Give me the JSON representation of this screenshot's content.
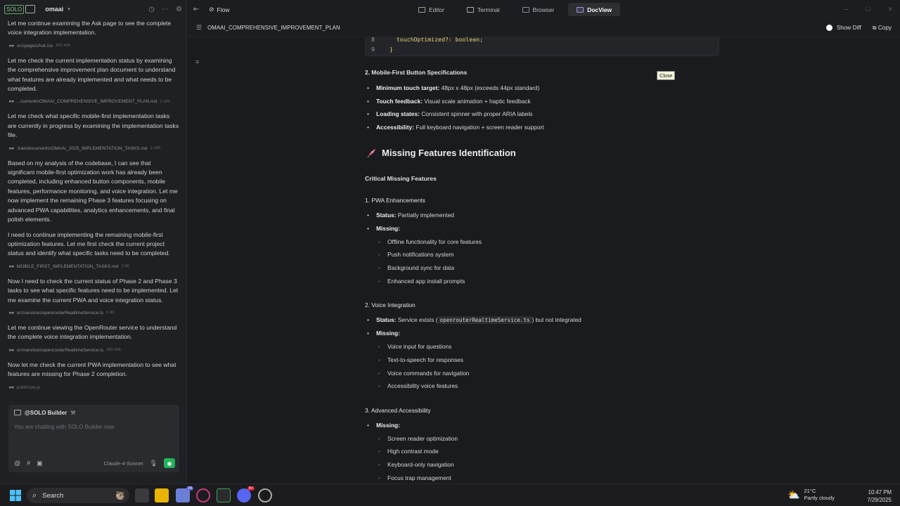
{
  "left_header": {
    "logo_text": "SOLO",
    "project": "omaai"
  },
  "chat": [
    {
      "text": "Let me continue examining the Ask page to see the complete voice integration implementation.",
      "ref": "src\\pages\\Ask.tsx",
      "range": "201-400"
    },
    {
      "text": "Let me check the current implementation status by examining the comprehensive improvement plan document to understand what features are already implemented and what needs to be completed.",
      "ref": "...cuments\\OMAAI_COMPREHENSIVE_IMPROVEMENT_PLAN.md",
      "range": "1-100"
    },
    {
      "text": "Let me check what specific mobile-first implementation tasks are currently in progress by examining the implementation tasks file.",
      "ref": ".trae\\documents\\OMAAI_2025_IMPLEMENTATION_TASKS.md",
      "range": "1-100"
    },
    {
      "text": "Based on my analysis of the codebase, I can see that significant mobile-first optimization work has already been completed, including enhanced button components, mobile features, performance monitoring, and voice integration. Let me now implement the remaining Phase 3 features focusing on advanced PWA capabilities, analytics enhancements, and final polish elements.",
      "ref": "",
      "range": ""
    },
    {
      "text": "I need to continue implementing the remaining mobile-first optimization features. Let me first check the current project status and identify what specific tasks need to be completed.",
      "ref": "MOBILE_FIRST_IMPLEMENTATION_TASKS.md",
      "range": "1-30"
    },
    {
      "text": "Now I need to check the current status of Phase 2 and Phase 3 tasks to see what specific features need to be implemented. Let me examine the current PWA and voice integration status.",
      "ref": "src\\services\\openrouterRealtimeService.ts",
      "range": "1-30"
    },
    {
      "text": "Let me continue viewing the OpenRouter service to understand the complete voice integration implementation.",
      "ref": "src\\services\\openrouterRealtimeService.ts",
      "range": "200-305"
    },
    {
      "text": "Now let me check the current PWA implementation to see what features are missing for Phase 2 completion.",
      "ref": "public\\sw.js",
      "range": ""
    }
  ],
  "composer": {
    "context": "@SOLO Builder",
    "placeholder": "You are chatting with SOLO Builder now",
    "model": "Claude-4-Sonnet"
  },
  "topbar": {
    "flow": "Flow",
    "tabs": [
      {
        "label": "Editor",
        "icon": "editor-icon"
      },
      {
        "label": "Terminal",
        "icon": "terminal-icon"
      },
      {
        "label": "Browser",
        "icon": "browser-icon"
      },
      {
        "label": "DocView",
        "icon": "docview-icon"
      }
    ],
    "active_tab": "DocView"
  },
  "doc_header": {
    "filename": "OMAAI_COMPREHENSIVE_IMPROVEMENT_PLAN",
    "show_diff": "Show Diff",
    "copy": "Copy"
  },
  "tooltip": "Close",
  "doc": {
    "code_lines": [
      {
        "n": "8",
        "code": "  touchOptimized?: boolean;"
      },
      {
        "n": "9",
        "code": "}"
      }
    ],
    "button_spec_title": "2. Mobile-First Button Specifications",
    "button_specs": [
      {
        "label": "Minimum touch target:",
        "text": "48px x 48px (exceeds 44px standard)"
      },
      {
        "label": "Touch feedback:",
        "text": "Visual scale animation + haptic feedback"
      },
      {
        "label": "Loading states:",
        "text": "Consistent spinner with proper ARIA labels"
      },
      {
        "label": "Accessibility:",
        "text": "Full keyboard navigation + screen reader support"
      }
    ],
    "missing_title": "Missing Features Identification",
    "critical_title": "Critical Missing Features",
    "pwa": {
      "title": "1. PWA Enhancements",
      "status_label": "Status:",
      "status": "Partially implemented",
      "missing_label": "Missing:",
      "items": [
        "Offline functionality for core features",
        "Push notifications system",
        "Background sync for data",
        "Enhanced app install prompts"
      ]
    },
    "voice": {
      "title": "2. Voice Integration",
      "status_label": "Status:",
      "status_pre": "Service exists (",
      "status_code": "openrouterRealtimeService.ts",
      "status_post": ") but not integrated",
      "missing_label": "Missing:",
      "items": [
        "Voice input for questions",
        "Text-to-speech for responses",
        "Voice commands for navigation",
        "Accessibility voice features"
      ]
    },
    "a11y": {
      "title": "3. Advanced Accessibility",
      "missing_label": "Missing:",
      "items": [
        "Screen reader optimization",
        "High contrast mode",
        "Keyboard-only navigation",
        "Focus trap management"
      ]
    }
  },
  "taskbar": {
    "search": "Search",
    "temp": "21°C",
    "weather": "Partly cloudy",
    "time": "10:47 PM",
    "date": "7/29/2025",
    "badge_mail": "24",
    "badge_discord": "9+"
  }
}
